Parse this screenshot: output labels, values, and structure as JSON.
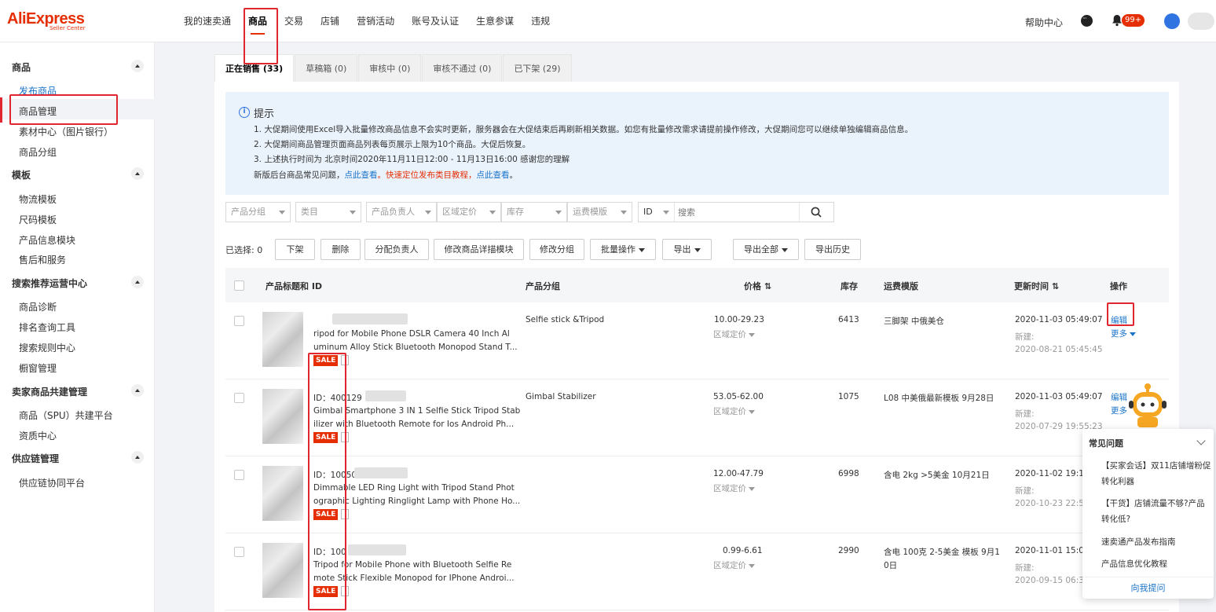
{
  "header": {
    "logo": "AliExpress",
    "logo_sub": "Seller Center",
    "nav": [
      "我的速卖通",
      "商品",
      "交易",
      "店铺",
      "营销活动",
      "账号及认证",
      "生意参谋",
      "违规"
    ],
    "help": "帮助中心",
    "notification_count": "99+"
  },
  "sidebar": {
    "groups": [
      {
        "title": "商品",
        "items": [
          "发布商品",
          "商品管理",
          "素材中心（图片银行）",
          "商品分组"
        ]
      },
      {
        "title": "模板",
        "items": [
          "物流模板",
          "尺码模板",
          "产品信息模块",
          "售后和服务"
        ]
      },
      {
        "title": "搜索推荐运营中心",
        "items": [
          "商品诊断",
          "排名查询工具",
          "搜索规则中心",
          "橱窗管理"
        ]
      },
      {
        "title": "卖家商品共建管理",
        "items": [
          "商品（SPU）共建平台",
          "资质中心"
        ]
      },
      {
        "title": "供应链管理",
        "items": [
          "供应链协同平台"
        ]
      }
    ]
  },
  "tabs": [
    "正在销售 (33)",
    "草稿箱 (0)",
    "审核中 (0)",
    "审核不通过 (0)",
    "已下架 (29)"
  ],
  "notice": {
    "title": "提示",
    "line1": "1. 大促期间使用Excel导入批量修改商品信息不会实时更新，服务器会在大促结束后再刷新相关数据。如您有批量修改需求请提前操作修改，大促期间您可以继续单独编辑商品信息。",
    "line2": "2. 大促期间商品管理页面商品列表每页展示上限为10个商品。大促后恢复。",
    "line3": "3. 上述执行时间为 北京时间2020年11月11日12:00 - 11月13日16:00 感谢您的理解",
    "line4_prefix": "新版后台商品常见问题，",
    "line4_link1": "点此查看",
    "line4_mid": "。快速定位发布类目教程，",
    "line4_link2": "点此查看",
    "line4_suffix": "。"
  },
  "filters": {
    "selects": [
      "产品分组",
      "类目",
      "产品负责人",
      "区域定价",
      "库存",
      "运费模版"
    ],
    "search_type": "ID",
    "search_placeholder": "搜索"
  },
  "actions": {
    "selected_label": "已选择: 0",
    "buttons": [
      "下架",
      "删除",
      "分配负责人",
      "修改商品详描模块",
      "修改分组",
      "批量操作",
      "导出",
      "导出全部",
      "导出历史"
    ]
  },
  "table": {
    "headers": [
      "产品标题和 ID",
      "产品分组",
      "价格",
      "库存",
      "运费模版",
      "更新时间",
      "操作"
    ],
    "sort_icon": "⇅",
    "rows": [
      {
        "id": "",
        "title1": "ripod for Mobile Phone DSLR Camera 40 Inch Al",
        "title2": "uminum Alloy Stick Bluetooth Monopod Stand T...",
        "group": "Selfie stick &Tripod",
        "price": "10.00-29.23",
        "region": "区域定价",
        "stock": "6413",
        "shipping1": "三脚架 中俄美仓",
        "shipping2": "",
        "updated": "2020-11-03 05:49:07",
        "new_label": "新建:",
        "created": "2020-08-21 05:45:45",
        "edit": "编辑",
        "more": "更多"
      },
      {
        "id": "ID：400129",
        "title1": "Gimbal Smartphone 3 IN 1 Selfie Stick Tripod Stab",
        "title2": "ilizer with Bluetooth Remote for Ios Android Ph...",
        "group": "Gimbal Stabilizer",
        "price": "53.05-62.00",
        "region": "区域定价",
        "stock": "1075",
        "shipping1": "L08 中美俄最新模板 9月28日",
        "shipping2": "",
        "updated": "2020-11-03 05:49:07",
        "new_label": "新建:",
        "created": "2020-07-29 19:55:23",
        "edit": "编辑",
        "more": "更多"
      },
      {
        "id": "ID：10050",
        "title1": "Dimmable LED Ring Light with Tripod Stand Phot",
        "title2": "ographic Lighting Ringlight Lamp with Phone Ho...",
        "group": "",
        "price": "12.00-47.79",
        "region": "区域定价",
        "stock": "6998",
        "shipping1": "含电 2kg >5美金 10月21日",
        "shipping2": "",
        "updated": "2020-11-02 19:12",
        "new_label": "新建:",
        "created": "2020-10-23 22:58",
        "edit": "",
        "more": ""
      },
      {
        "id": "ID：100",
        "title1": "Tripod for Mobile Phone with Bluetooth Selfie Re",
        "title2": "mote Stick Flexible Monopod for IPhone Androi...",
        "group": "",
        "price": "0.99-6.61",
        "region": "区域定价",
        "stock": "2990",
        "shipping1": "含电 100克 2-5美金 模板 9月1",
        "shipping2": "0日",
        "updated": "2020-11-01 15:01",
        "new_label": "新建:",
        "created": "2020-09-15 06:31",
        "edit": "",
        "more": ""
      }
    ],
    "sale_label": "SALE"
  },
  "faq": {
    "title": "常见问题",
    "items": [
      "【买家会话】双11店铺增粉促转化利器",
      "【干货】店铺流量不够?产品转化低?",
      "速卖通产品发布指南",
      "产品信息优化教程"
    ],
    "ask": "向我提问"
  },
  "colors": {
    "brand": "#e62e04",
    "link": "#1a73c9",
    "annotation": "#e0262f"
  }
}
